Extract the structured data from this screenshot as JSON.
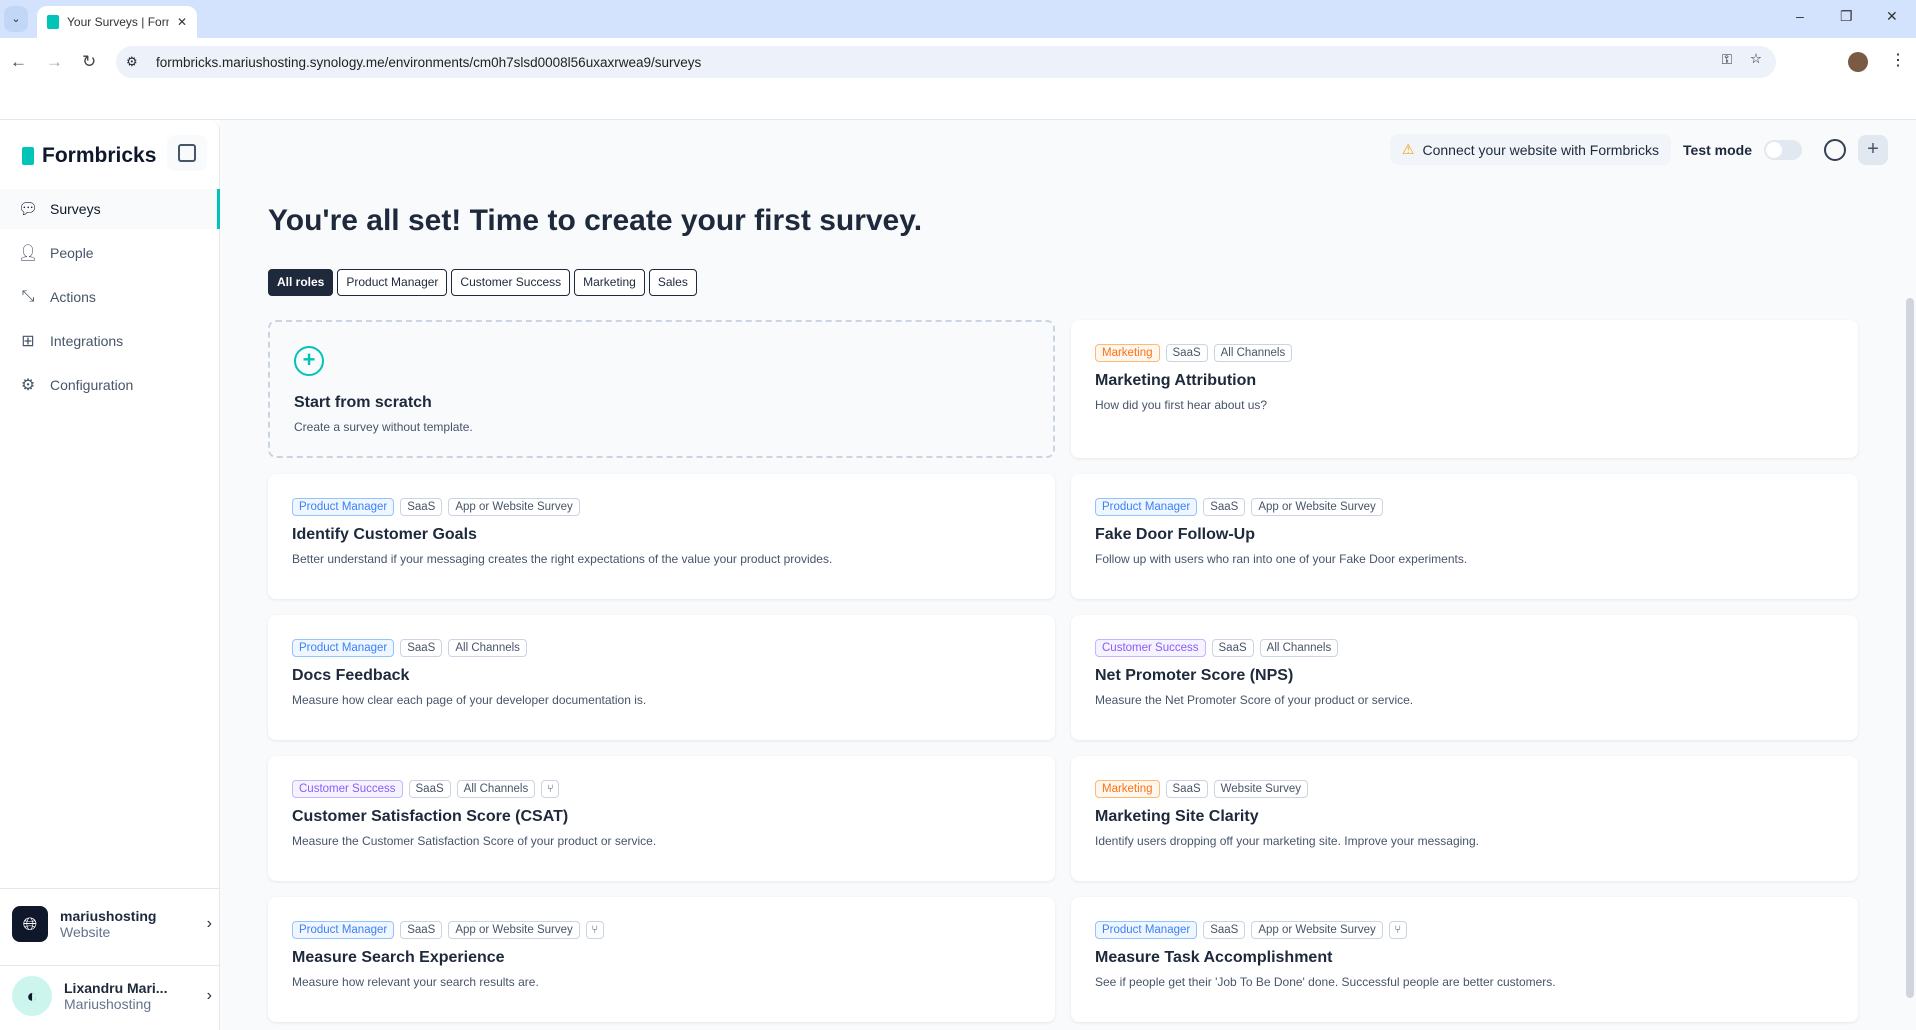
{
  "browser": {
    "tab_title": "Your Surveys | Formbricks",
    "url": "formbricks.mariushosting.synology.me/environments/cm0h7slsd0008l56uxaxrwea9/surveys"
  },
  "sidebar": {
    "brand": "Formbricks",
    "items": [
      {
        "label": "Surveys",
        "icon": "chat-bubble-icon"
      },
      {
        "label": "People",
        "icon": "user-icon"
      },
      {
        "label": "Actions",
        "icon": "cursor-click-icon"
      },
      {
        "label": "Integrations",
        "icon": "blocks-icon"
      },
      {
        "label": "Configuration",
        "icon": "gear-icon"
      }
    ],
    "project": {
      "name": "mariushosting",
      "type": "Website"
    },
    "user": {
      "name": "Lixandru Mari...",
      "org": "Mariushosting"
    }
  },
  "header": {
    "connect": "Connect your website with Formbricks",
    "test_mode": "Test mode",
    "test_mode_on": false
  },
  "main": {
    "title": "You're all set! Time to create your first survey.",
    "roles": [
      "All roles",
      "Product Manager",
      "Customer Success",
      "Marketing",
      "Sales"
    ],
    "scratch": {
      "title": "Start from scratch",
      "desc": "Create a survey without template."
    },
    "templates": [
      {
        "tags": [
          [
            "Marketing",
            "mk"
          ],
          [
            "SaaS",
            ""
          ],
          [
            "All Channels",
            ""
          ]
        ],
        "branch": false,
        "title": "Marketing Attribution",
        "desc": "How did you first hear about us?"
      },
      {
        "tags": [
          [
            "Product Manager",
            "pm"
          ],
          [
            "SaaS",
            ""
          ],
          [
            "App or Website Survey",
            ""
          ]
        ],
        "branch": false,
        "title": "Identify Customer Goals",
        "desc": "Better understand if your messaging creates the right expectations of the value your product provides."
      },
      {
        "tags": [
          [
            "Product Manager",
            "pm"
          ],
          [
            "SaaS",
            ""
          ],
          [
            "App or Website Survey",
            ""
          ]
        ],
        "branch": false,
        "title": "Fake Door Follow-Up",
        "desc": "Follow up with users who ran into one of your Fake Door experiments."
      },
      {
        "tags": [
          [
            "Product Manager",
            "pm"
          ],
          [
            "SaaS",
            ""
          ],
          [
            "All Channels",
            ""
          ]
        ],
        "branch": false,
        "title": "Docs Feedback",
        "desc": "Measure how clear each page of your developer documentation is."
      },
      {
        "tags": [
          [
            "Customer Success",
            "cs"
          ],
          [
            "SaaS",
            ""
          ],
          [
            "All Channels",
            ""
          ]
        ],
        "branch": false,
        "title": "Net Promoter Score (NPS)",
        "desc": "Measure the Net Promoter Score of your product or service."
      },
      {
        "tags": [
          [
            "Customer Success",
            "cs"
          ],
          [
            "SaaS",
            ""
          ],
          [
            "All Channels",
            ""
          ]
        ],
        "branch": true,
        "title": "Customer Satisfaction Score (CSAT)",
        "desc": "Measure the Customer Satisfaction Score of your product or service."
      },
      {
        "tags": [
          [
            "Marketing",
            "mk"
          ],
          [
            "SaaS",
            ""
          ],
          [
            "Website Survey",
            ""
          ]
        ],
        "branch": false,
        "title": "Marketing Site Clarity",
        "desc": "Identify users dropping off your marketing site. Improve your messaging."
      },
      {
        "tags": [
          [
            "Product Manager",
            "pm"
          ],
          [
            "SaaS",
            ""
          ],
          [
            "App or Website Survey",
            ""
          ]
        ],
        "branch": true,
        "title": "Measure Search Experience",
        "desc": "Measure how relevant your search results are."
      },
      {
        "tags": [
          [
            "Product Manager",
            "pm"
          ],
          [
            "SaaS",
            ""
          ],
          [
            "App or Website Survey",
            ""
          ]
        ],
        "branch": true,
        "title": "Measure Task Accomplishment",
        "desc": "See if people get their 'Job To Be Done' done. Successful people are better customers."
      }
    ]
  },
  "colors": {
    "brand": "#00c4b8",
    "dark": "#1e293b"
  }
}
